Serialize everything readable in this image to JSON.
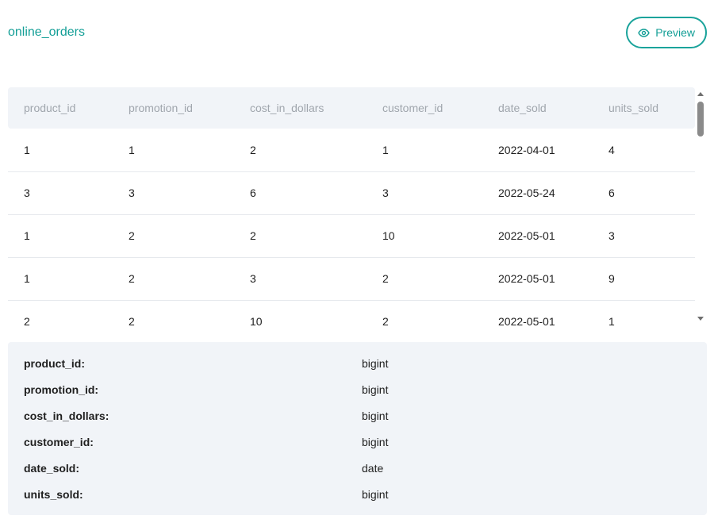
{
  "header": {
    "table_name": "online_orders",
    "preview_label": "Preview",
    "preview_icon": "eye-icon"
  },
  "table": {
    "columns": [
      "product_id",
      "promotion_id",
      "cost_in_dollars",
      "customer_id",
      "date_sold",
      "units_sold"
    ],
    "rows": [
      [
        "1",
        "1",
        "2",
        "1",
        "2022-04-01",
        "4"
      ],
      [
        "3",
        "3",
        "6",
        "3",
        "2022-05-24",
        "6"
      ],
      [
        "1",
        "2",
        "2",
        "10",
        "2022-05-01",
        "3"
      ],
      [
        "1",
        "2",
        "3",
        "2",
        "2022-05-01",
        "9"
      ],
      [
        "2",
        "2",
        "10",
        "2",
        "2022-05-01",
        "1"
      ]
    ]
  },
  "schema": [
    {
      "name": "product_id:",
      "type": "bigint"
    },
    {
      "name": "promotion_id:",
      "type": "bigint"
    },
    {
      "name": "cost_in_dollars:",
      "type": "bigint"
    },
    {
      "name": "customer_id:",
      "type": "bigint"
    },
    {
      "name": "date_sold:",
      "type": "date"
    },
    {
      "name": "units_sold:",
      "type": "bigint"
    }
  ],
  "colors": {
    "accent": "#129e96",
    "header_bg": "#f1f4f8",
    "header_text": "#a0a6ad",
    "divider": "#e6e9ed"
  }
}
